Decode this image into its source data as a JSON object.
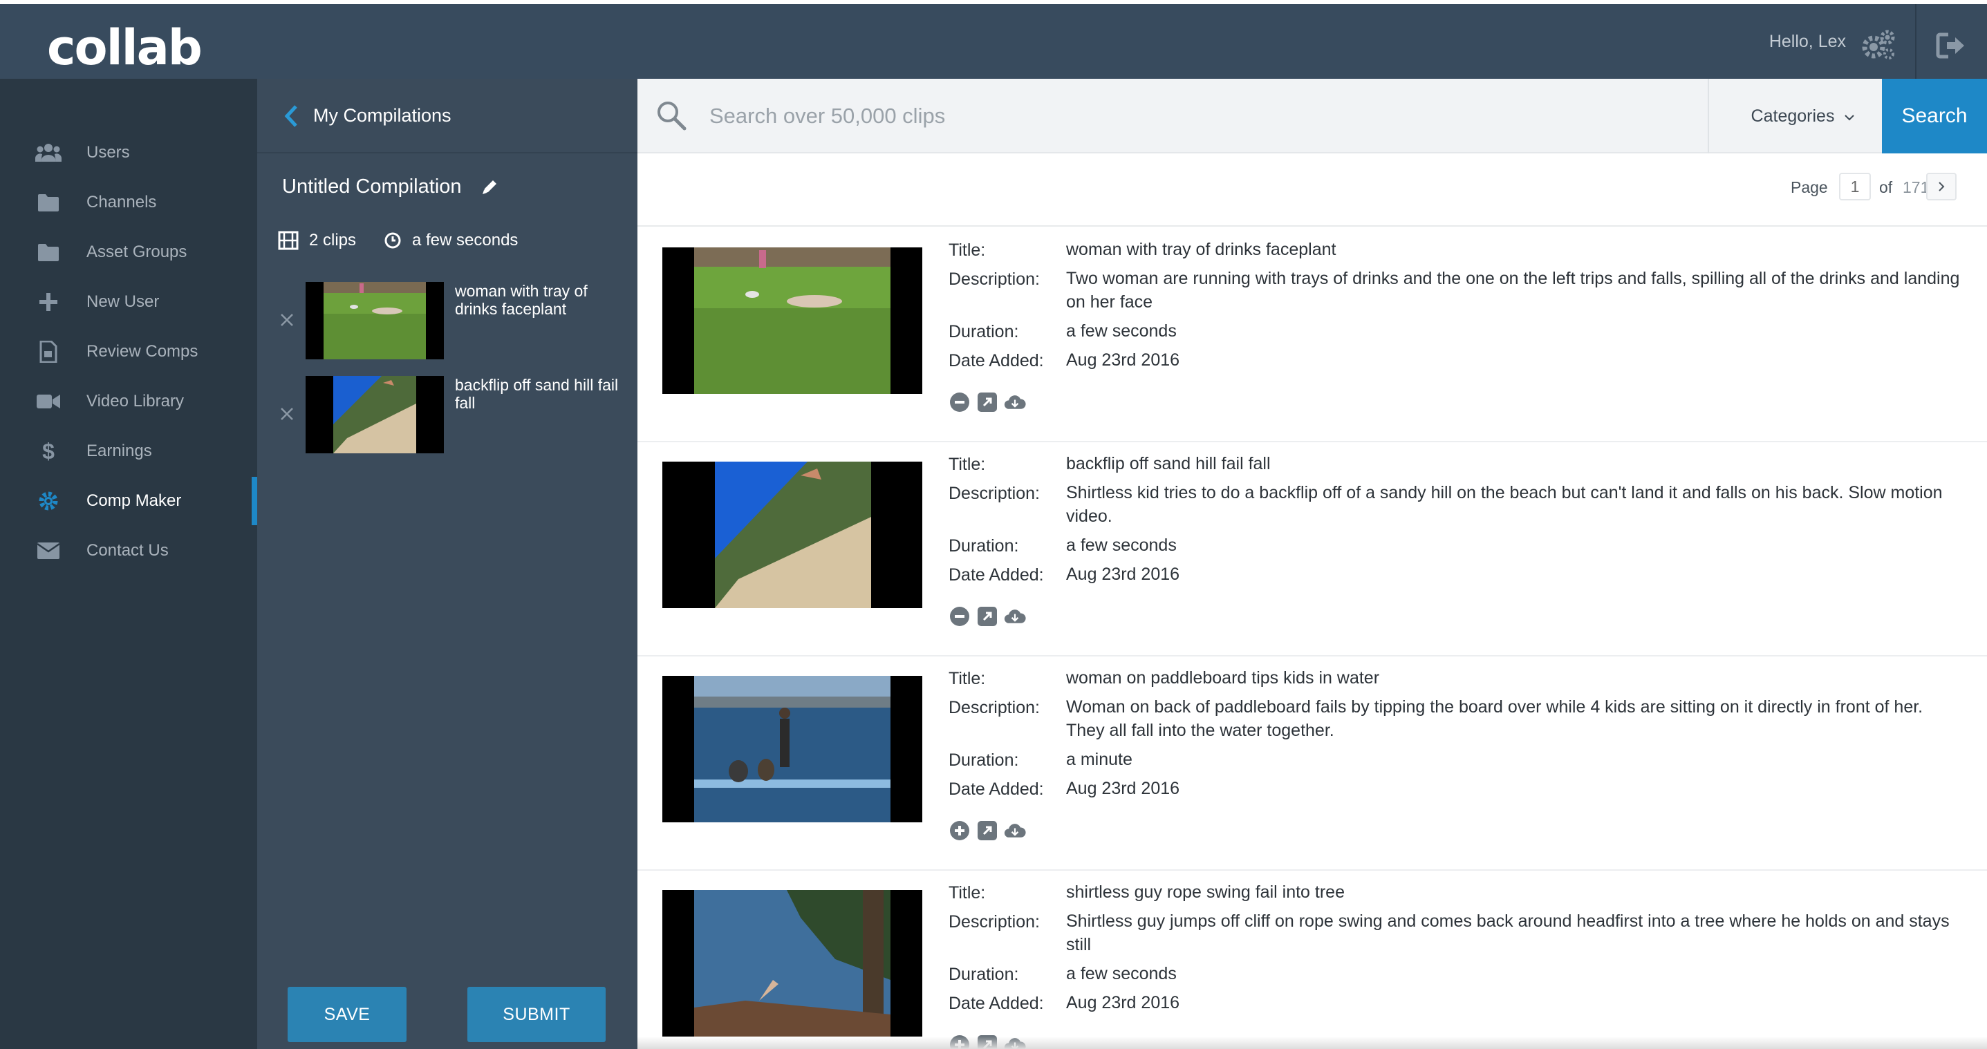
{
  "app": {
    "logo": "collab",
    "greeting": "Hello, Lex",
    "icons": {
      "settings": "gears-icon",
      "logout": "logout-icon"
    }
  },
  "sidebar": {
    "items": [
      {
        "label": "Users",
        "icon": "users-icon",
        "active": false
      },
      {
        "label": "Channels",
        "icon": "folder-icon",
        "active": false
      },
      {
        "label": "Asset Groups",
        "icon": "folder-icon",
        "active": false
      },
      {
        "label": "New User",
        "icon": "plus-icon",
        "active": false
      },
      {
        "label": "Review Comps",
        "icon": "document-icon",
        "active": false
      },
      {
        "label": "Video Library",
        "icon": "video-camera-icon",
        "active": false
      },
      {
        "label": "Earnings",
        "icon": "dollar-icon",
        "active": false
      },
      {
        "label": "Comp Maker",
        "icon": "gear-icon",
        "active": true
      },
      {
        "label": "Contact Us",
        "icon": "envelope-icon",
        "active": false
      }
    ],
    "accent_color": "#1e88c7"
  },
  "compilation": {
    "back_label": "My Compilations",
    "name": "Untitled Compilation",
    "clip_count": "2 clips",
    "duration": "a few seconds",
    "clips": [
      {
        "title": "woman with tray of drinks faceplant"
      },
      {
        "title": "backflip off sand hill fail fall"
      }
    ],
    "save_label": "SAVE",
    "submit_label": "SUBMIT"
  },
  "search": {
    "placeholder": "Search over 50,000 clips",
    "categories_label": "Categories",
    "button_label": "Search"
  },
  "pager": {
    "page_label": "Page",
    "current": "1",
    "of_label": "of",
    "total": "171"
  },
  "labels": {
    "title": "Title:",
    "description": "Description:",
    "duration": "Duration:",
    "date_added": "Date Added:"
  },
  "results": [
    {
      "title": "woman with tray of drinks faceplant",
      "description": "Two woman are running with trays of drinks and the one on the left trips and falls, spilling all of the drinks and landing on her face",
      "duration": "a few seconds",
      "date_added": "Aug 23rd 2016",
      "in_compilation": true
    },
    {
      "title": "backflip off sand hill fail fall",
      "description": "Shirtless kid tries to do a backflip off of a sandy hill on the beach but can't land it and falls on his back. Slow motion video.",
      "duration": "a few seconds",
      "date_added": "Aug 23rd 2016",
      "in_compilation": true
    },
    {
      "title": "woman on paddleboard tips kids in water",
      "description": "Woman on back of paddleboard fails by tipping the board over while 4 kids are sitting on it directly in front of her. They all fall into the water together.",
      "duration": "a minute",
      "date_added": "Aug 23rd 2016",
      "in_compilation": false
    },
    {
      "title": "shirtless guy rope swing fail into tree",
      "description": "Shirtless guy jumps off cliff on rope swing and comes back around headfirst into a tree where he holds on and stays still",
      "duration": "a few seconds",
      "date_added": "Aug 23rd 2016",
      "in_compilation": false
    }
  ]
}
